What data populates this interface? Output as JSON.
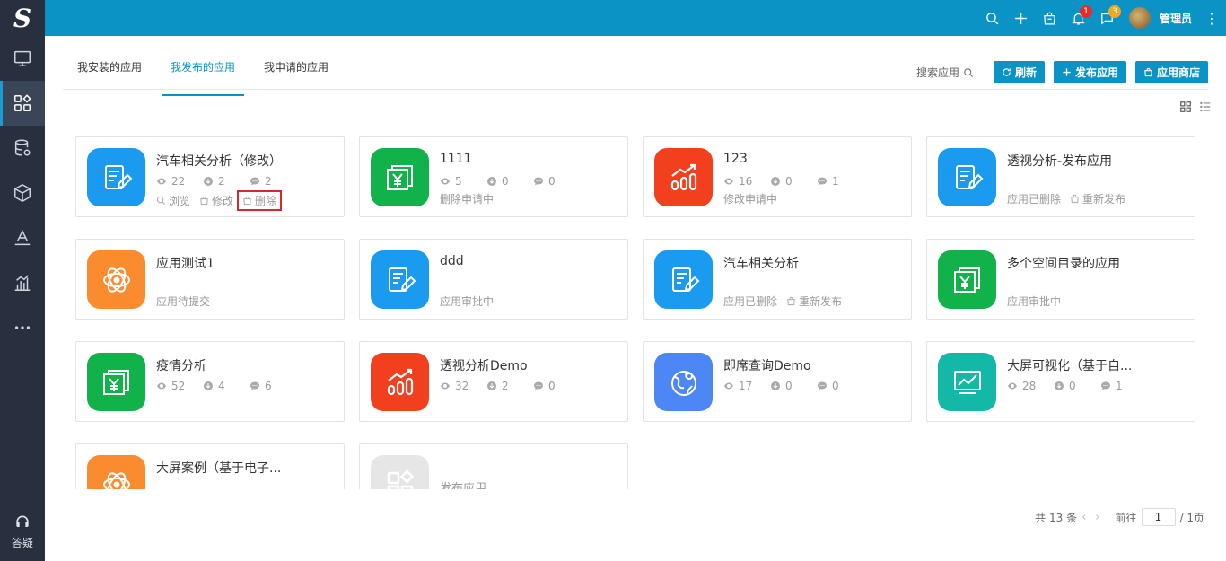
{
  "sidebar": {
    "logo": "S",
    "items": [
      {
        "name": "monitor-icon"
      },
      {
        "name": "apps-icon"
      },
      {
        "name": "database-icon"
      },
      {
        "name": "cube-icon"
      },
      {
        "name": "layers-icon"
      },
      {
        "name": "bar-chart-icon"
      },
      {
        "name": "more-icon"
      }
    ],
    "help_label": "答疑"
  },
  "topbar": {
    "notifications_count": "1",
    "messages_count": "3",
    "username": "管理员"
  },
  "tabs": [
    {
      "label": "我安装的应用"
    },
    {
      "label": "我发布的应用"
    },
    {
      "label": "我申请的应用"
    }
  ],
  "actions": {
    "search_label": "搜索应用",
    "refresh": "刷新",
    "publish": "发布应用",
    "store": "应用商店"
  },
  "cards": [
    {
      "title": "汽车相关分析（修改）",
      "color": "#1a9bf0",
      "icon": "form-edit-icon",
      "views": "22",
      "downloads": "2",
      "comments": "2",
      "ops": [
        "浏览",
        "修改",
        "删除"
      ]
    },
    {
      "title": "1111",
      "color": "#12b24a",
      "icon": "yuan-icon",
      "views": "5",
      "downloads": "0",
      "comments": "0",
      "status": "删除申请中"
    },
    {
      "title": "123",
      "color": "#f2401f",
      "icon": "trend-bars-icon",
      "views": "16",
      "downloads": "0",
      "comments": "1",
      "status": "修改申请中"
    },
    {
      "title": "透视分析-发布应用",
      "color": "#1a9bf0",
      "icon": "form-edit-icon",
      "status": "应用已删除",
      "status_op": "重新发布"
    },
    {
      "title": "应用测试1",
      "color": "#fa8c2f",
      "icon": "atom-icon",
      "status": "应用待提交"
    },
    {
      "title": "ddd",
      "color": "#1a9bf0",
      "icon": "form-edit-icon",
      "status": "应用审批中"
    },
    {
      "title": "汽车相关分析",
      "color": "#1a9bf0",
      "icon": "form-edit-icon",
      "status": "应用已删除",
      "status_op": "重新发布"
    },
    {
      "title": "多个空间目录的应用",
      "color": "#12b24a",
      "icon": "yuan-icon",
      "status": "应用审批中"
    },
    {
      "title": "疫情分析",
      "color": "#12b24a",
      "icon": "yuan-icon",
      "views": "52",
      "downloads": "4",
      "comments": "6"
    },
    {
      "title": "透视分析Demo",
      "color": "#f2401f",
      "icon": "trend-bars-icon",
      "views": "32",
      "downloads": "2",
      "comments": "0"
    },
    {
      "title": "即席查询Demo",
      "color": "#4d86f5",
      "icon": "globe-pin-icon",
      "views": "17",
      "downloads": "0",
      "comments": "0"
    },
    {
      "title": "大屏可视化（基于自...",
      "color": "#13b8a6",
      "icon": "screen-chart-icon",
      "views": "28",
      "downloads": "0",
      "comments": "1"
    },
    {
      "title": "大屏案例（基于电子...",
      "color": "#fa8c2f",
      "icon": "atom-icon"
    },
    {
      "title": "发布应用",
      "color": "#e6e6e6",
      "icon": "apps-icon",
      "placeholder": true
    }
  ],
  "pagination": {
    "total": "共 13 条",
    "goto_label": "前往",
    "page": "1",
    "pages": "/ 1页"
  }
}
